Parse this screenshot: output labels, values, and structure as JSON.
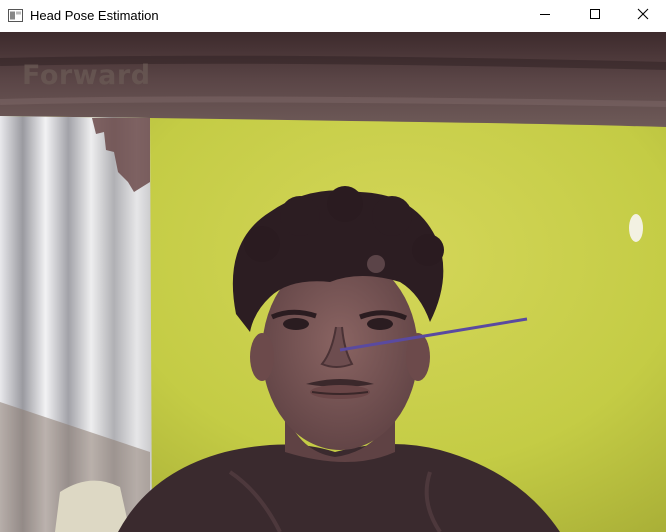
{
  "window": {
    "title": "Head Pose Estimation",
    "app_icon": "window-app-icon",
    "controls": {
      "minimize_icon": "minimize-icon",
      "maximize_icon": "maximize-icon",
      "close_icon": "close-icon"
    }
  },
  "video": {
    "pose_label": "Forward",
    "pose_label_color": "#6a5a55",
    "direction_line_color": "#5a4aa0",
    "background_wall_color": "#c7cf48"
  }
}
